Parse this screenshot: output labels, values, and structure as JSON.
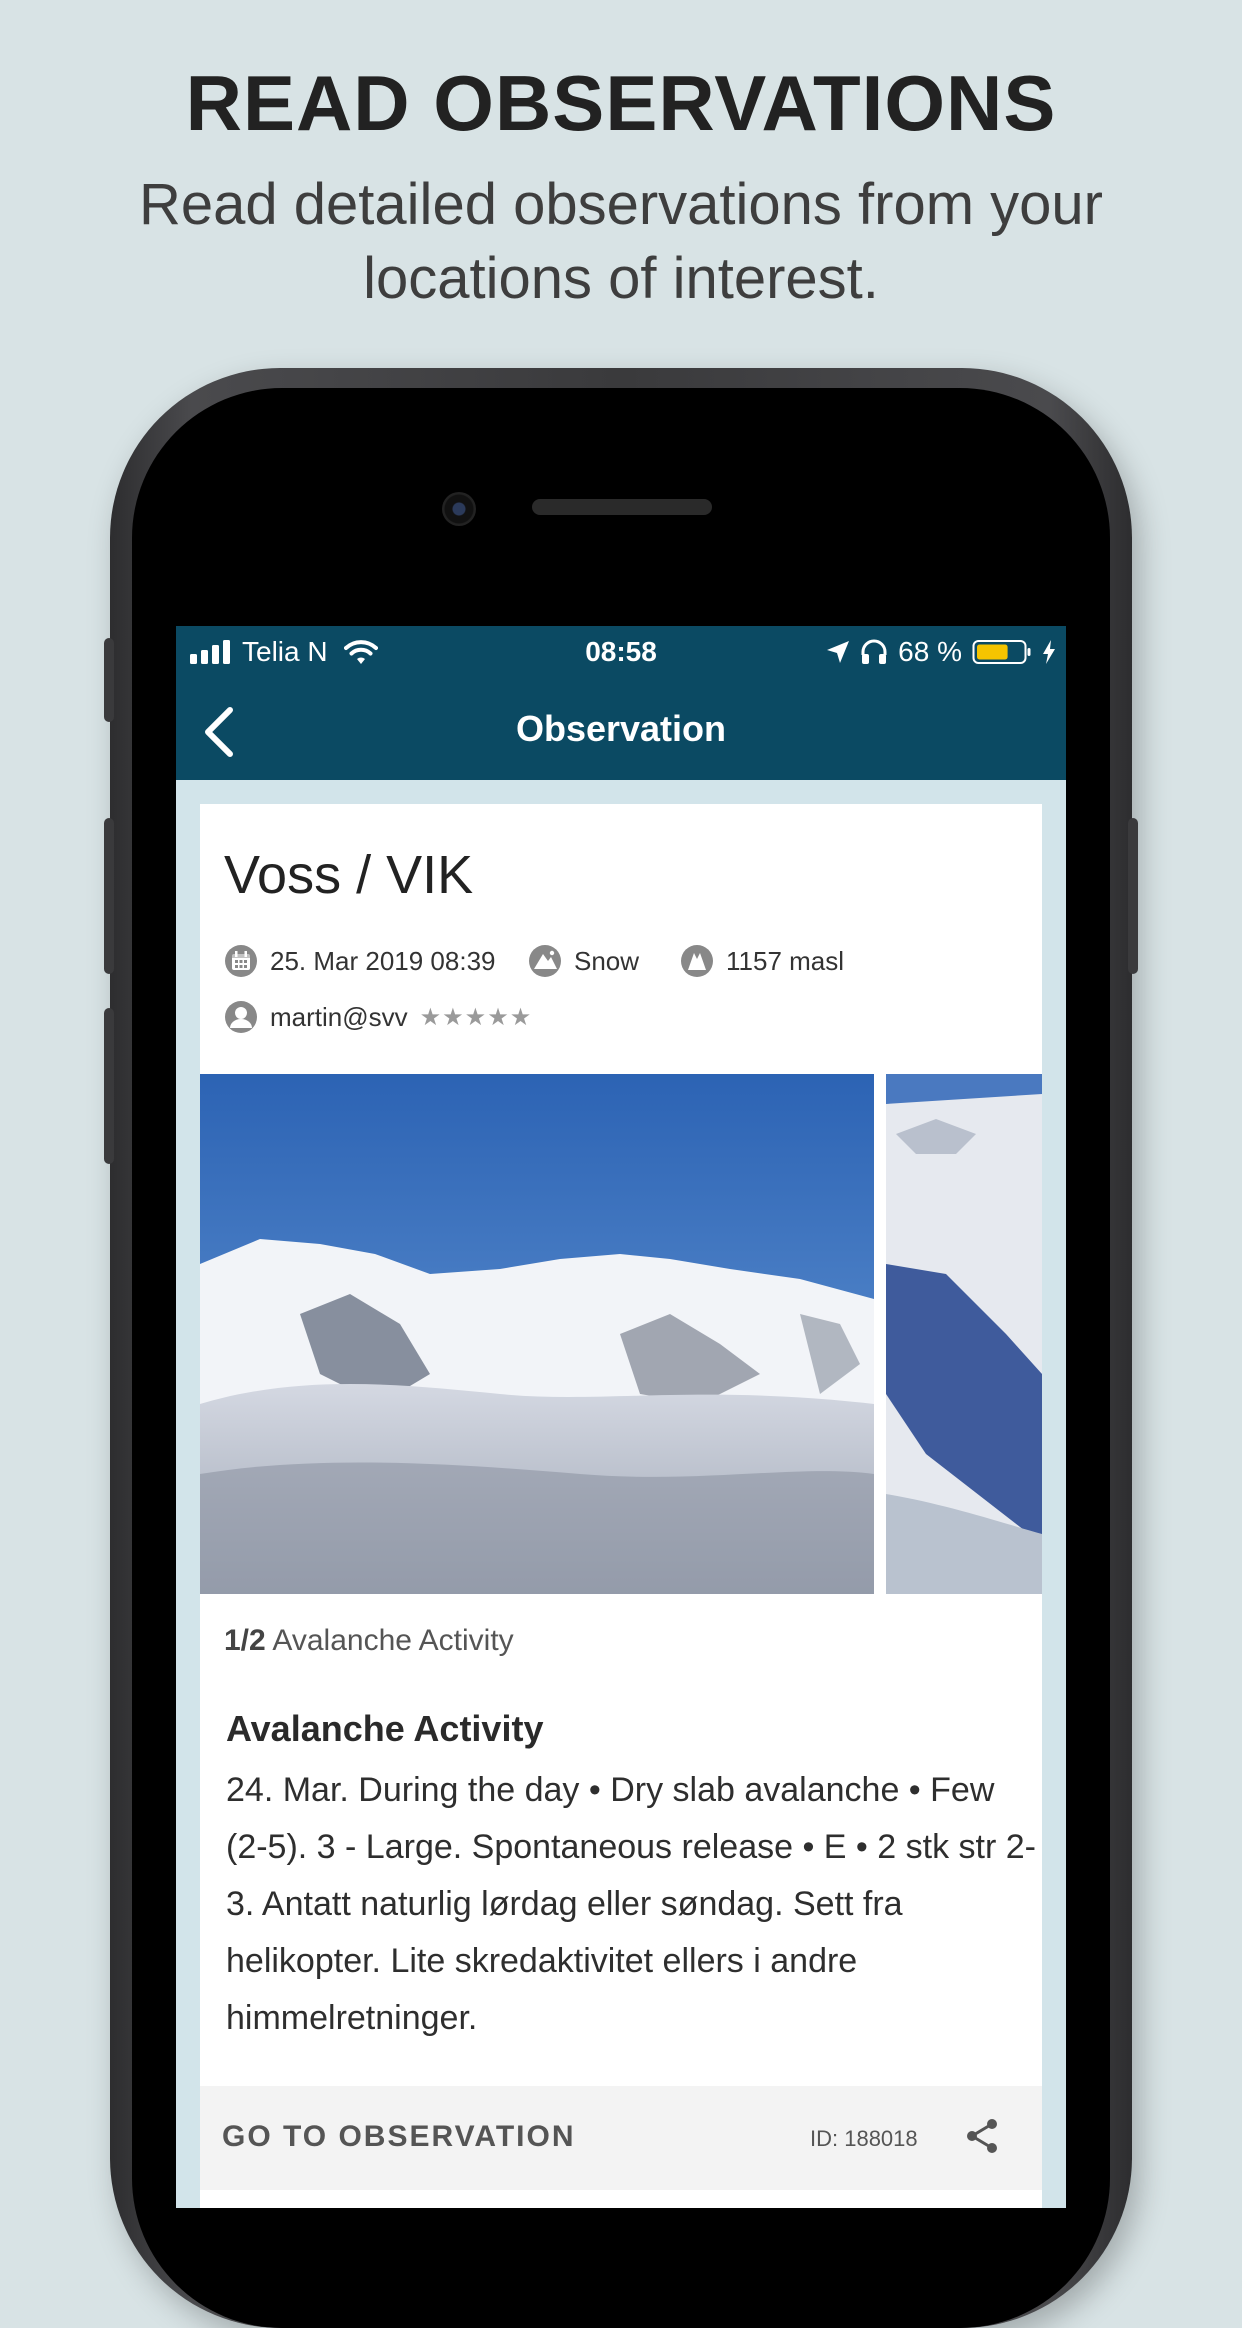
{
  "promo": {
    "headline": "READ OBSERVATIONS",
    "subline": "Read detailed observations from your locations of interest."
  },
  "statusbar": {
    "carrier": "Telia N",
    "time": "08:58",
    "battery_percent": "68 %",
    "battery_level": 0.68,
    "icons": [
      "signal-icon",
      "wifi-icon",
      "location-arrow-icon",
      "headphones-icon",
      "battery-icon",
      "charging-icon"
    ]
  },
  "navbar": {
    "title": "Observation",
    "back_icon": "chevron-left-icon"
  },
  "observation": {
    "location": "Voss / VIK",
    "date": "25. Mar 2019 08:39",
    "category": "Snow",
    "elevation": "1157 masl",
    "observer": "martin@svv",
    "competence_stars": "★★★★★",
    "photo_counter_current": "1/2",
    "photo_caption": "Avalanche Activity",
    "section_title": "Avalanche Activity",
    "section_body": "24. Mar. During the day • Dry slab avalanche • Few (2-5). 3 - Large. Spontaneous release • E • 2 stk str 2-3. Antatt naturlig lørdag eller søndag. Sett fra helikopter. Lite skredaktivitet ellers i andre himmelretninger.",
    "goto_label": "GO TO OBSERVATION",
    "id_label": "ID: 188018"
  },
  "colors": {
    "background": "#d8e3e5",
    "header": "#0b4a63",
    "screen_bg": "#d2e4ea",
    "battery": "#f5c400"
  }
}
